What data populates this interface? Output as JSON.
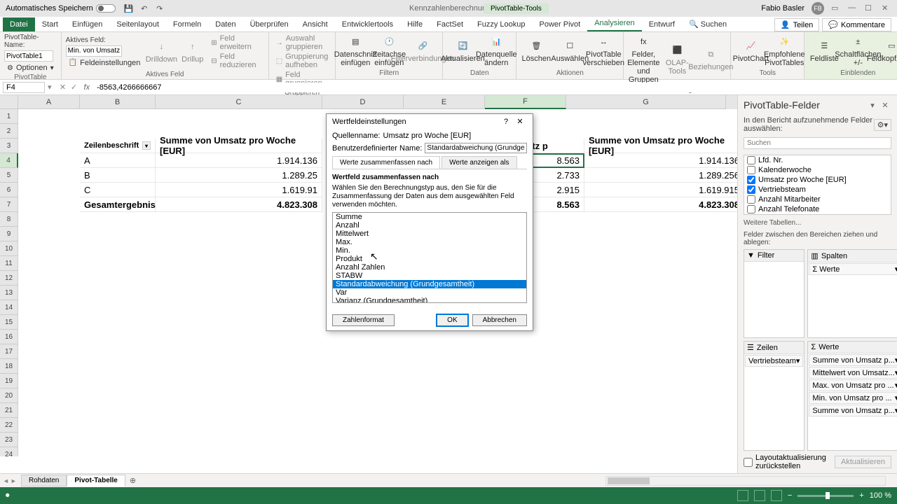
{
  "titlebar": {
    "autosave": "Automatisches Speichern",
    "doc_title": "Kennzahlenberechnung - Excel",
    "pivot_tools": "PivotTable-Tools",
    "user_name": "Fabio Basler",
    "user_initials": "FB"
  },
  "tabs": {
    "file": "Datei",
    "start": "Start",
    "einfugen": "Einfügen",
    "seitenlayout": "Seitenlayout",
    "formeln": "Formeln",
    "daten": "Daten",
    "uberprufen": "Überprüfen",
    "ansicht": "Ansicht",
    "entwickler": "Entwicklertools",
    "hilfe": "Hilfe",
    "factset": "FactSet",
    "fuzzy": "Fuzzy Lookup",
    "powerpivot": "Power Pivot",
    "analysieren": "Analysieren",
    "entwurf": "Entwurf",
    "suchen": "Suchen",
    "teilen": "Teilen",
    "kommentare": "Kommentare"
  },
  "ribbon": {
    "pt_name_label": "PivotTable-Name:",
    "pt_name": "PivotTable1",
    "pt_options": "Optionen",
    "active_field_label": "Aktives Feld:",
    "active_field": "Min. von Umsatz",
    "field_settings": "Feldeinstellungen",
    "drilldown": "Drilldown",
    "drillup": "Drillup",
    "expand": "Feld erweitern",
    "collapse": "Feld reduzieren",
    "group_sel": "Auswahl gruppieren",
    "group_cancel": "Gruppierung aufheben",
    "group_field": "Feld gruppieren",
    "slicer": "Datenschnitt einfügen",
    "timeline": "Zeitachse einfügen",
    "filter_conn": "Filterverbindungen",
    "refresh": "Aktualisieren",
    "change_src": "Datenquelle ändern",
    "clear": "Löschen",
    "select": "Auswählen",
    "move": "PivotTable verschieben",
    "calc_fields": "Felder, Elemente und Gruppen",
    "olap": "OLAP-Tools",
    "relations": "Beziehungen",
    "pivotchart": "PivotChart",
    "recommended": "Empfohlene PivotTables",
    "fieldlist": "Feldliste",
    "buttons": "Schaltflächen +/-",
    "headers": "Feldkopfzeilen",
    "grp_pivottable": "PivotTable",
    "grp_activefield": "Aktives Feld",
    "grp_group": "Gruppieren",
    "grp_filter": "Filtern",
    "grp_data": "Daten",
    "grp_actions": "Aktionen",
    "grp_calc": "Berechnungen",
    "grp_tools": "Tools",
    "grp_show": "Einblenden"
  },
  "formula_bar": {
    "name_box": "F4",
    "formula": "-8563,4266666667"
  },
  "columns": [
    "A",
    "B",
    "C",
    "D",
    "E",
    "F",
    "G"
  ],
  "grid": {
    "b3": "Zeilenbeschrift",
    "c3": "Summe von Umsatz pro Woche [EUR]",
    "f3": "Umsatz p",
    "g3": "Summe von Umsatz pro Woche [EUR]",
    "b4": "A",
    "c4": "1.914.136",
    "f4": "8.563",
    "g4": "1.914.136",
    "b5": "B",
    "c5": "1.289.25",
    "f5": "2.733",
    "g5": "1.289.256",
    "b6": "C",
    "c6": "1.619.91",
    "f6": "2.915",
    "g6": "1.619.915",
    "b7": "Gesamtergebnis",
    "c7": "4.823.308",
    "f7": "8.563",
    "g7": "4.823.308"
  },
  "dialog": {
    "title": "Wertfeldeinstellungen",
    "src_label": "Quellenname:",
    "src_value": "Umsatz pro Woche [EUR]",
    "custom_label": "Benutzerdefinierter Name:",
    "custom_value": "Standardabweichung (Grundgesamtheit) von Umsatz p",
    "tab1": "Werte zusammenfassen nach",
    "tab2": "Werte anzeigen als",
    "section_title": "Wertfeld zusammenfassen nach",
    "section_desc": "Wählen Sie den Berechnungstyp aus, den Sie für die Zusammenfassung der Daten aus dem ausgewählten Feld verwenden möchten.",
    "options": [
      "Summe",
      "Anzahl",
      "Mittelwert",
      "Max.",
      "Min.",
      "Produkt",
      "Anzahl Zahlen",
      "STABW",
      "Standardabweichung (Grundgesamtheit)",
      "Var",
      "Varianz (Grundgesamtheit)"
    ],
    "selected_index": 8,
    "number_format": "Zahlenformat",
    "ok": "OK",
    "cancel": "Abbrechen"
  },
  "task_pane": {
    "title": "PivotTable-Felder",
    "desc": "In den Bericht aufzunehmende Felder auswählen:",
    "search_placeholder": "Suchen",
    "fields": [
      {
        "label": "Lfd. Nr.",
        "checked": false
      },
      {
        "label": "Kalenderwoche",
        "checked": false
      },
      {
        "label": "Umsatz pro Woche [EUR]",
        "checked": true
      },
      {
        "label": "Vertriebsteam",
        "checked": true
      },
      {
        "label": "Anzahl Mitarbeiter",
        "checked": false
      },
      {
        "label": "Anzahl Telefonate",
        "checked": false
      }
    ],
    "more_tables": "Weitere Tabellen...",
    "areas_label": "Felder zwischen den Bereichen ziehen und ablegen:",
    "area_filter": "Filter",
    "area_columns": "Spalten",
    "area_rows": "Zeilen",
    "area_values": "Werte",
    "columns_items": [
      "Σ Werte"
    ],
    "rows_items": [
      "Vertriebsteam"
    ],
    "values_items": [
      "Summe von Umsatz p...",
      "Mittelwert von Umsatz...",
      "Max. von Umsatz pro ...",
      "Min. von Umsatz pro ...",
      "Summe von Umsatz p..."
    ],
    "defer_label": "Layoutaktualisierung zurückstellen",
    "update": "Aktualisieren"
  },
  "sheets": {
    "rohdaten": "Rohdaten",
    "pivot": "Pivot-Tabelle"
  },
  "status": {
    "zoom": "100 %"
  }
}
